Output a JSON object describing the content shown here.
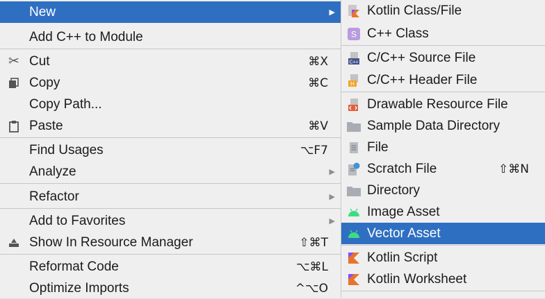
{
  "context_menu": {
    "items": [
      {
        "label": "New",
        "has_submenu": true,
        "selected": true
      },
      {
        "label": "Add C++ to Module"
      },
      {
        "label": "Cut",
        "shortcut": "⌘X",
        "icon": "scissors-icon"
      },
      {
        "label": "Copy",
        "shortcut": "⌘C",
        "icon": "copy-icon"
      },
      {
        "label": "Copy Path..."
      },
      {
        "label": "Paste",
        "shortcut": "⌘V",
        "icon": "clipboard-icon"
      },
      {
        "label": "Find Usages",
        "shortcut": "⌥F7"
      },
      {
        "label": "Analyze",
        "has_submenu": true
      },
      {
        "label": "Refactor",
        "has_submenu": true
      },
      {
        "label": "Add to Favorites",
        "has_submenu": true
      },
      {
        "label": "Show In Resource Manager",
        "shortcut": "⇧⌘T",
        "icon": "resource-manager-icon"
      },
      {
        "label": "Reformat Code",
        "shortcut": "⌥⌘L"
      },
      {
        "label": "Optimize Imports",
        "shortcut": "^⌥O"
      }
    ]
  },
  "submenu": {
    "items": [
      {
        "label": "Kotlin Class/File",
        "icon": "kotlin-file-icon"
      },
      {
        "label": "C++ Class",
        "icon": "cpp-class-icon",
        "icon_text": "S"
      },
      {
        "label": "C/C++ Source File",
        "icon": "cpp-source-file-icon",
        "icon_text": "C++"
      },
      {
        "label": "C/C++ Header File",
        "icon": "cpp-header-file-icon",
        "icon_text": "H"
      },
      {
        "label": "Drawable Resource File",
        "icon": "drawable-file-icon"
      },
      {
        "label": "Sample Data Directory",
        "icon": "folder-icon"
      },
      {
        "label": "File",
        "icon": "file-icon"
      },
      {
        "label": "Scratch File",
        "shortcut": "⇧⌘N",
        "icon": "scratch-file-icon"
      },
      {
        "label": "Directory",
        "icon": "folder-icon"
      },
      {
        "label": "Image Asset",
        "icon": "android-icon"
      },
      {
        "label": "Vector Asset",
        "icon": "android-icon",
        "selected": true
      },
      {
        "label": "Kotlin Script",
        "icon": "kotlin-script-icon"
      },
      {
        "label": "Kotlin Worksheet",
        "icon": "kotlin-worksheet-icon"
      }
    ]
  },
  "colors": {
    "selection": "#2f6fc2",
    "menu_background": "#efefef",
    "separator": "#c6c6c6"
  }
}
